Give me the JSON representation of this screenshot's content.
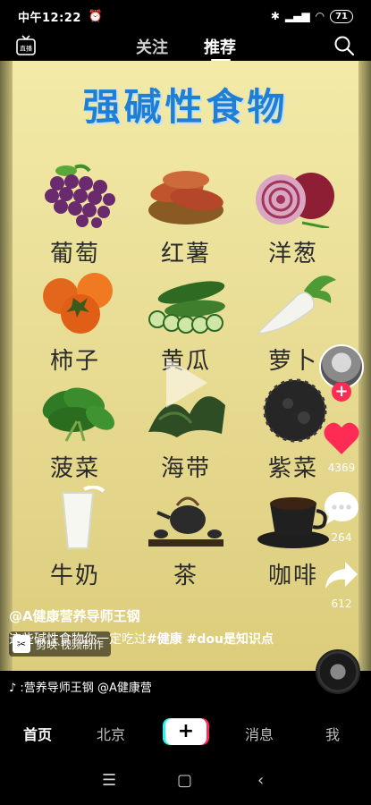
{
  "status_bar": {
    "time": "中午12:22",
    "battery": "71"
  },
  "top_nav": {
    "live_label": "直播",
    "tabs": [
      "关注",
      "推荐"
    ],
    "active_tab": "推荐"
  },
  "video": {
    "title": "强碱性食物",
    "foods": [
      "葡萄",
      "红薯",
      "洋葱",
      "柿子",
      "黄瓜",
      "萝卜",
      "菠菜",
      "海带",
      "紫菜",
      "牛奶",
      "茶",
      "咖啡"
    ],
    "watermark": "剪映·视频制作"
  },
  "side_actions": {
    "likes": "4369",
    "comments": "264",
    "shares": "612"
  },
  "post": {
    "author": "@A健康营养导师王钢",
    "caption_text": "这些碱性食物你一定吃过",
    "caption_tags": "#健康 #dou是知识点",
    "music": "♪ :营养导师王钢    @A健康营"
  },
  "bottom_nav": {
    "items": [
      "首页",
      "北京",
      "消息",
      "我"
    ],
    "active": "首页",
    "plus": "+"
  },
  "colors": {
    "title_blue": "#1e7fd4",
    "like_red": "#fe2c55",
    "accent_cyan": "#25f4ee"
  }
}
